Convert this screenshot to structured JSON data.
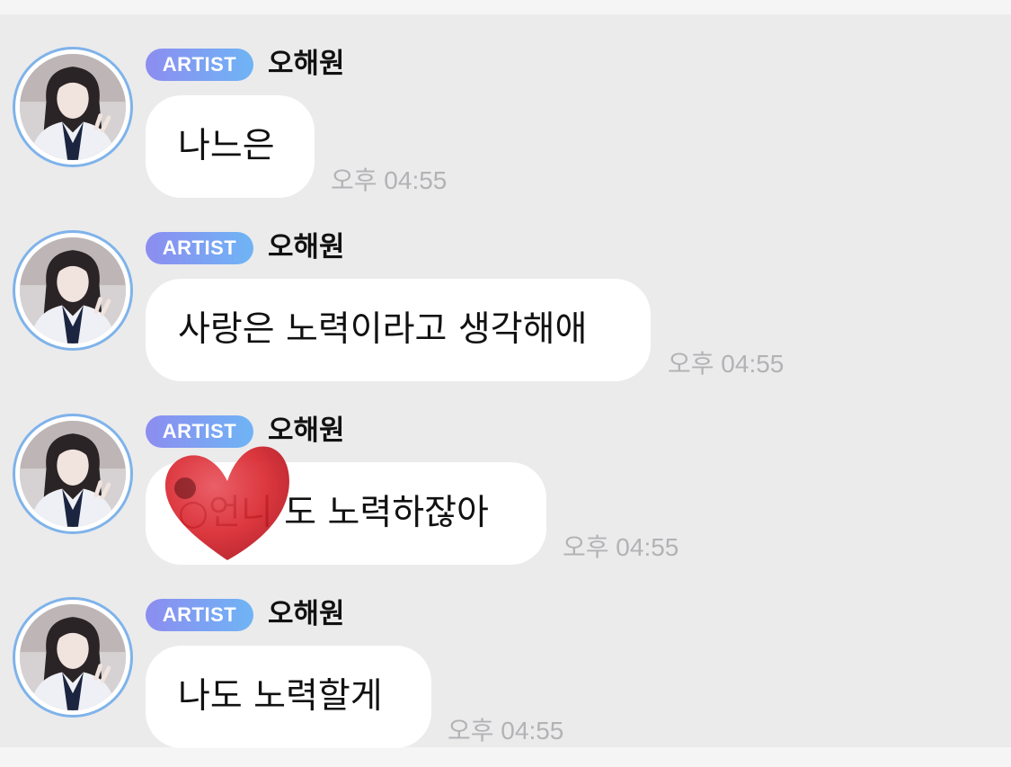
{
  "chat": {
    "messages": [
      {
        "badge": "ARTIST",
        "sender": "오해원",
        "text": "나느은",
        "time": "오후 04:55"
      },
      {
        "badge": "ARTIST",
        "sender": "오해원",
        "text": "사랑은 노력이라고 생각해애",
        "time": "오후 04:55"
      },
      {
        "badge": "ARTIST",
        "sender": "오해원",
        "text": "○언니 도 노력하잖아",
        "time": "오후 04:55"
      },
      {
        "badge": "ARTIST",
        "sender": "오해원",
        "text": "나도 노력할게",
        "time": "오후 04:55"
      }
    ]
  },
  "colors": {
    "chat_background": "#ebebec",
    "bubble": "#ffffff",
    "badge_gradient_start": "#8c8df0",
    "badge_gradient_end": "#6fb4f5",
    "avatar_ring": "#7fb3ea",
    "timestamp": "#b3b3b6",
    "heart_sticker": "#d9262e"
  },
  "icons": {
    "heart_sticker": "heart-sticker-icon"
  }
}
